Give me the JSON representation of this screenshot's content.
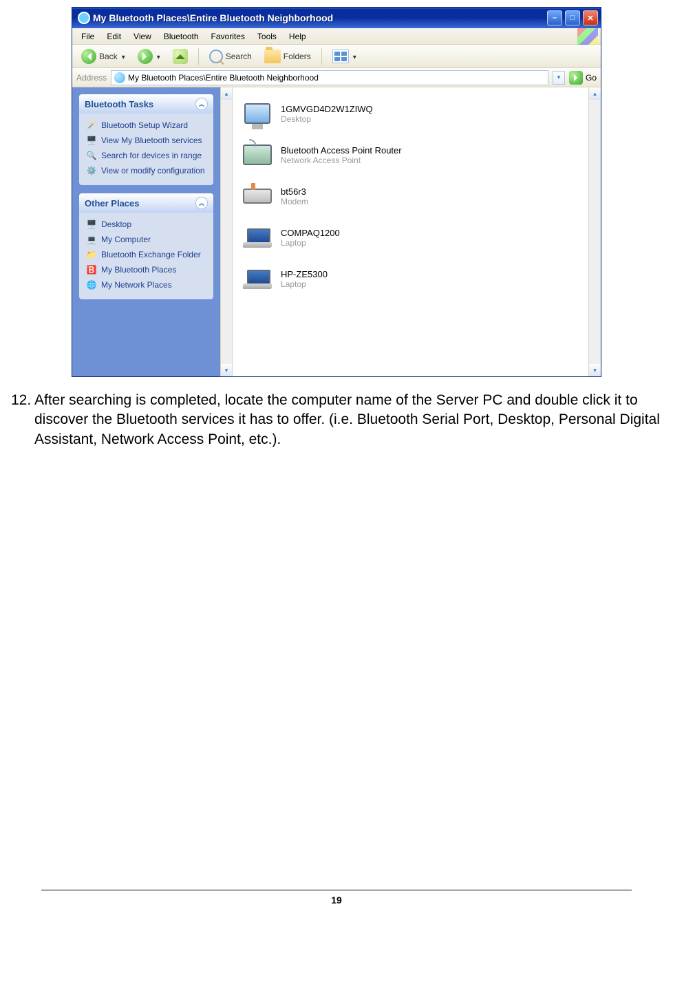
{
  "window": {
    "title": "My Bluetooth Places\\Entire Bluetooth Neighborhood"
  },
  "menu": {
    "file": "File",
    "edit": "Edit",
    "view": "View",
    "bluetooth": "Bluetooth",
    "favorites": "Favorites",
    "tools": "Tools",
    "help": "Help"
  },
  "toolbar": {
    "back": "Back",
    "search": "Search",
    "folders": "Folders"
  },
  "address": {
    "label": "Address",
    "value": "My Bluetooth Places\\Entire Bluetooth Neighborhood",
    "go": "Go"
  },
  "panels": {
    "tasks_title": "Bluetooth Tasks",
    "tasks": [
      {
        "label": "Bluetooth Setup Wizard",
        "icon": "wizard"
      },
      {
        "label": "View My Bluetooth services",
        "icon": "services"
      },
      {
        "label": "Search for devices in range",
        "icon": "search"
      },
      {
        "label": "View or modify configuration",
        "icon": "config"
      }
    ],
    "other_title": "Other Places",
    "other": [
      {
        "label": "Desktop",
        "icon": "desktop"
      },
      {
        "label": "My Computer",
        "icon": "computer"
      },
      {
        "label": "Bluetooth Exchange Folder",
        "icon": "folder"
      },
      {
        "label": "My Bluetooth Places",
        "icon": "bt"
      },
      {
        "label": "My Network Places",
        "icon": "network"
      }
    ]
  },
  "devices": [
    {
      "name": "1GMVGD4D2W1ZIWQ",
      "type": "Desktop",
      "icon": "desktop"
    },
    {
      "name": "Bluetooth Access Point Router",
      "type": "Network Access Point",
      "icon": "ap"
    },
    {
      "name": "bt56r3",
      "type": "Modem",
      "icon": "modem"
    },
    {
      "name": "COMPAQ1200",
      "type": "Laptop",
      "icon": "laptop"
    },
    {
      "name": "HP-ZE5300",
      "type": "Laptop",
      "icon": "laptop"
    }
  ],
  "doc": {
    "step_number": "12.",
    "step_text": "After searching is completed, locate the computer name of the Server PC and double click it to discover the Bluetooth services it has to offer. (i.e. Bluetooth Serial Port, Desktop, Personal Digital Assistant, Network Access Point, etc.).",
    "page_number": "19"
  }
}
